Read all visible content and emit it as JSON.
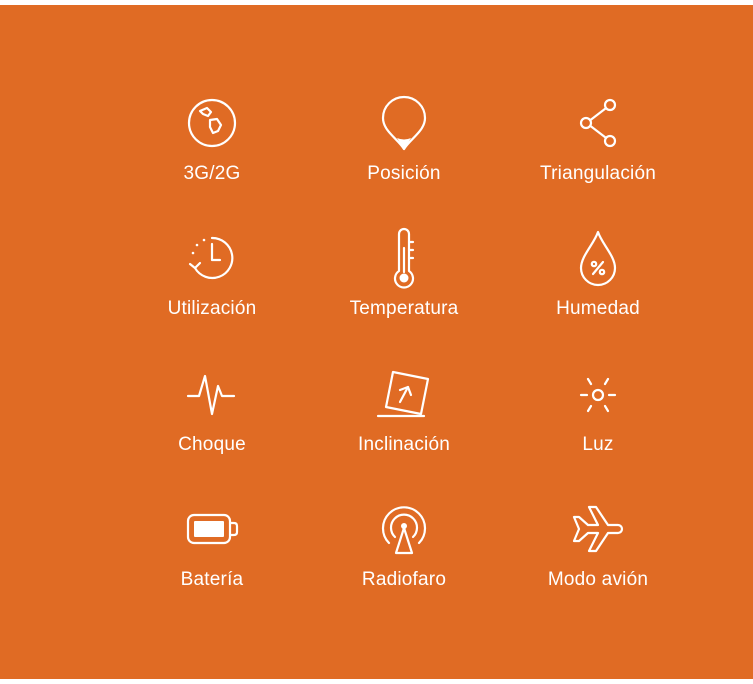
{
  "colors": {
    "background": "#e06b24",
    "foreground": "#ffffff"
  },
  "features": [
    {
      "icon": "globe-icon",
      "label": "3G/2G"
    },
    {
      "icon": "location-pin-icon",
      "label": "Posición"
    },
    {
      "icon": "share-nodes-icon",
      "label": "Triangulación"
    },
    {
      "icon": "clock-history-icon",
      "label": "Utilización"
    },
    {
      "icon": "thermometer-icon",
      "label": "Temperatura"
    },
    {
      "icon": "humidity-drop-icon",
      "label": "Humedad"
    },
    {
      "icon": "pulse-icon",
      "label": "Choque"
    },
    {
      "icon": "tilt-box-icon",
      "label": "Inclinación"
    },
    {
      "icon": "sun-icon",
      "label": "Luz"
    },
    {
      "icon": "battery-icon",
      "label": "Batería"
    },
    {
      "icon": "beacon-icon",
      "label": "Radiofaro"
    },
    {
      "icon": "airplane-icon",
      "label": "Modo avión"
    }
  ]
}
